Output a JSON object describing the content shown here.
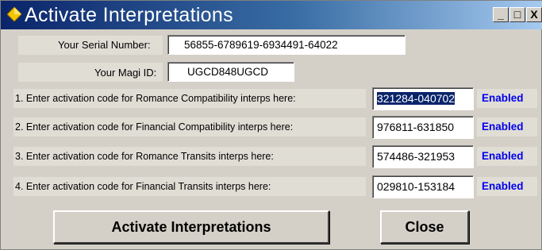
{
  "window": {
    "title": "Activate Interpretations",
    "minimize": "_",
    "maximize": "□",
    "close": "X"
  },
  "serial": {
    "label": "Your Serial Number:",
    "value": "56855-6789619-6934491-64022"
  },
  "magi": {
    "label": "Your Magi ID:",
    "value": "UGCD848UGCD"
  },
  "rows": [
    {
      "label": "1. Enter activation code for Romance Compatibility interps here:",
      "code": "321284-040702",
      "status": "Enabled"
    },
    {
      "label": "2. Enter activation code for Financial Compatibility interps here:",
      "code": "976811-631850",
      "status": "Enabled"
    },
    {
      "label": "3. Enter activation code for Romance Transits interps here:",
      "code": "574486-321953",
      "status": "Enabled"
    },
    {
      "label": "4. Enter activation code for Financial Transits interps here:",
      "code": "029810-153184",
      "status": "Enabled"
    }
  ],
  "buttons": {
    "activate": "Activate Interpretations",
    "close": "Close"
  },
  "colors": {
    "titlebar_start": "#0a246a",
    "titlebar_end": "#a6caf0",
    "status_text": "#0000ee",
    "dialog_bg": "#d4d0c8"
  },
  "icons": {
    "title_icon": "yellow-diamond-icon"
  }
}
